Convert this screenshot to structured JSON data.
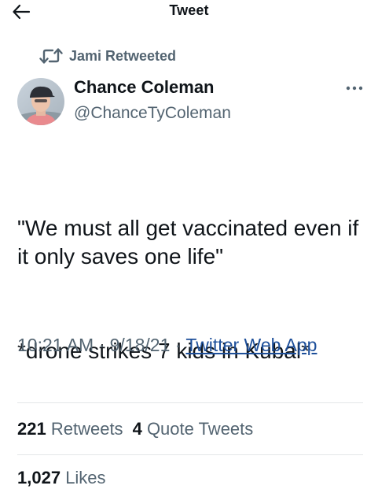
{
  "header": {
    "title": "Tweet",
    "back_icon": "arrow-left-icon"
  },
  "social_context": {
    "icon": "retweet-icon",
    "text": "Jami Retweeted"
  },
  "author": {
    "name": "Chance Coleman",
    "handle": "@ChanceTyColeman",
    "avatar": "user-avatar"
  },
  "more_icon": "more-horizontal-icon",
  "tweet": {
    "paragraphs": [
      "\"We must all get vaccinated even if it only saves one life\"",
      "*drone strikes 7 kids in Kubal*"
    ]
  },
  "meta": {
    "time": "10:21 AM",
    "separator": " · ",
    "date": "9/18/21",
    "source": "Twitter Web App"
  },
  "stats": {
    "retweets_count": "221",
    "retweets_label": "Retweets",
    "quotes_count": "4",
    "quotes_label": "Quote Tweets",
    "likes_count": "1,027",
    "likes_label": "Likes"
  },
  "colors": {
    "text_primary": "#0f1419",
    "text_secondary": "#536471",
    "link": "#1d4f9a",
    "divider": "#e3e6e8"
  }
}
